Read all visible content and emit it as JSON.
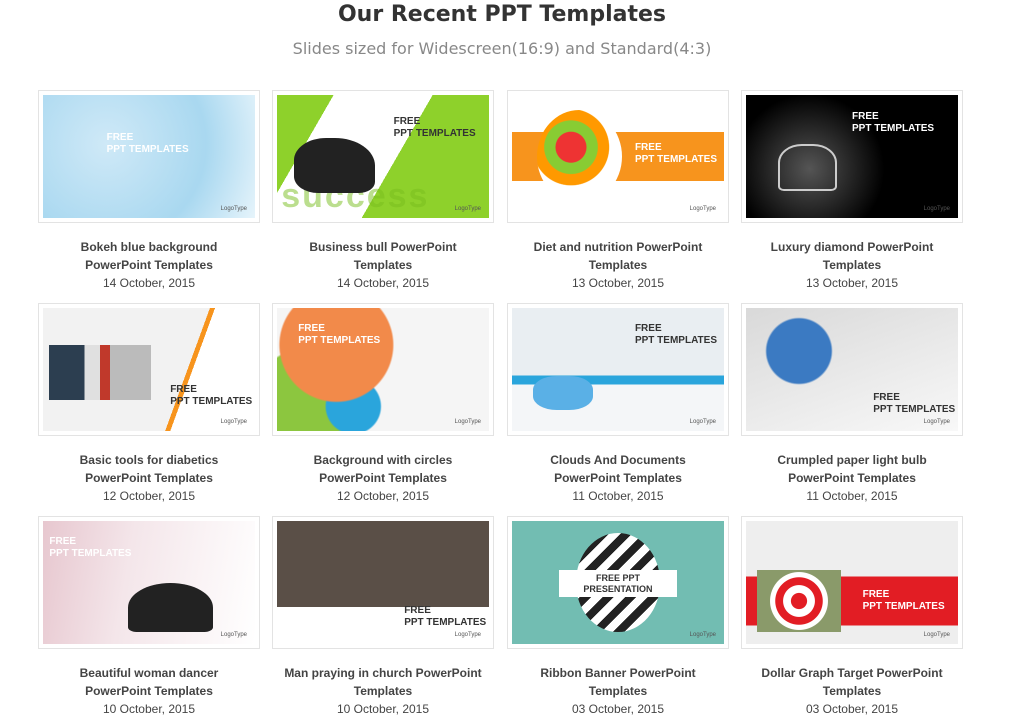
{
  "header": {
    "title": "Our Recent PPT Templates",
    "subtitle": "Slides sized for Widescreen(16:9) and Standard(4:3)"
  },
  "thumb_text": {
    "free": "FREE",
    "ppt": "PPT TEMPLATES",
    "free_ppt": "FREE PPT",
    "presentation": "PRESENTATION",
    "logo": "LogoType",
    "success": "success"
  },
  "templates": [
    {
      "name": "Bokeh blue background PowerPoint Templates",
      "date": "14 October, 2015"
    },
    {
      "name": "Business bull PowerPoint Templates",
      "date": "14 October, 2015"
    },
    {
      "name": "Diet and nutrition PowerPoint Templates",
      "date": "13 October, 2015"
    },
    {
      "name": "Luxury diamond PowerPoint Templates",
      "date": "13 October, 2015"
    },
    {
      "name": "Basic tools for diabetics PowerPoint Templates",
      "date": "12 October, 2015"
    },
    {
      "name": "Background with circles PowerPoint Templates",
      "date": "12 October, 2015"
    },
    {
      "name": "Clouds And Documents PowerPoint Templates",
      "date": "11 October, 2015"
    },
    {
      "name": "Crumpled paper light bulb PowerPoint Templates",
      "date": "11 October, 2015"
    },
    {
      "name": "Beautiful woman dancer PowerPoint Templates",
      "date": "10 October, 2015"
    },
    {
      "name": "Man praying in church PowerPoint Templates",
      "date": "10 October, 2015"
    },
    {
      "name": "Ribbon Banner PowerPoint Templates",
      "date": "03 October, 2015"
    },
    {
      "name": "Dollar Graph Target PowerPoint Templates",
      "date": "03 October, 2015"
    }
  ]
}
